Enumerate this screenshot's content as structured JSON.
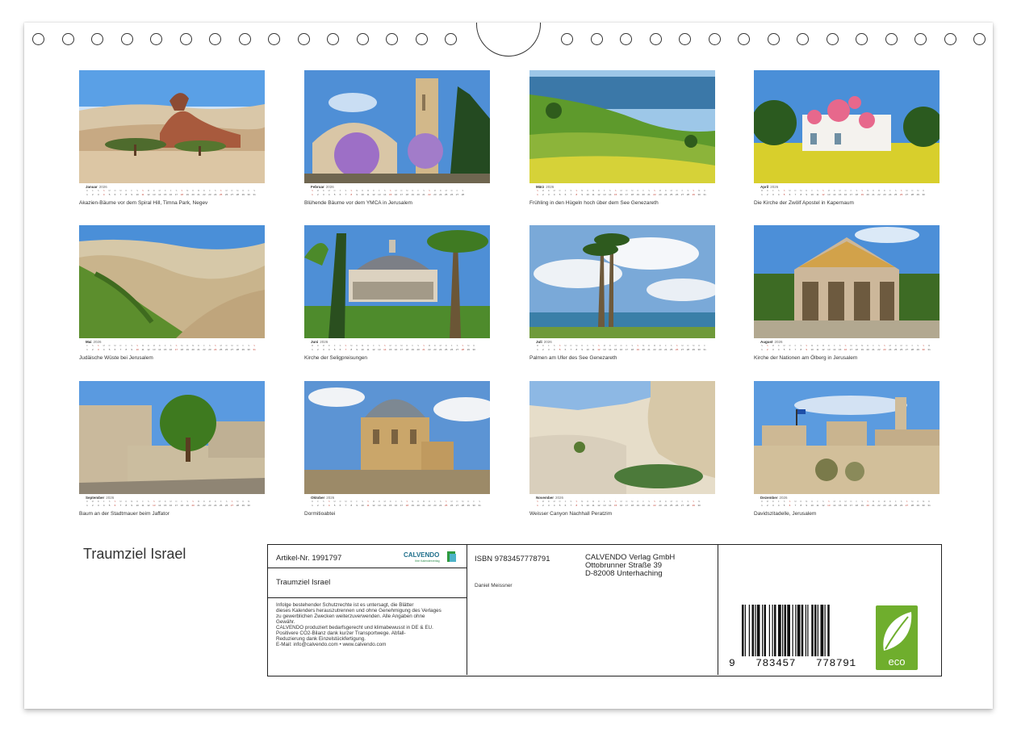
{
  "months": [
    {
      "name": "Januar",
      "year": "2026",
      "caption": "Akazien-Bäume vor dem Spiral Hill, Timna Park, Negev",
      "days": 31
    },
    {
      "name": "Februar",
      "year": "2026",
      "caption": "Blühende Bäume vor dem YMCA in Jerusalem",
      "days": 28
    },
    {
      "name": "März",
      "year": "2026",
      "caption": "Frühling in den Hügeln hoch über dem See Genezareth",
      "days": 31
    },
    {
      "name": "April",
      "year": "2026",
      "caption": "Die Kirche der Zwölf Apostel in Kapernaum",
      "days": 30
    },
    {
      "name": "Mai",
      "year": "2026",
      "caption": "Judäische Wüste bei Jerusalem",
      "days": 31
    },
    {
      "name": "Juni",
      "year": "2026",
      "caption": "Kirche der Seligpreisungen",
      "days": 30
    },
    {
      "name": "Juli",
      "year": "2026",
      "caption": "Palmen am Ufer des See Genezareth",
      "days": 31
    },
    {
      "name": "August",
      "year": "2026",
      "caption": "Kirche der Nationen am Ölberg in Jerusalem",
      "days": 31
    },
    {
      "name": "September",
      "year": "2026",
      "caption": "Baum an der Stadtmauer beim Jaffator",
      "days": 30
    },
    {
      "name": "Oktober",
      "year": "2026",
      "caption": "Dormitioabtei",
      "days": 31
    },
    {
      "name": "November",
      "year": "2026",
      "caption": "Weisser Canyon Nachhall Peratzim",
      "days": 30
    },
    {
      "name": "Dezember",
      "year": "2026",
      "caption": "Davidszitadelle, Jerusalem",
      "days": 31
    }
  ],
  "title": "Traumziel Israel",
  "info": {
    "article": "Artikel-Nr. 1991797",
    "brand": "CALVENDO",
    "brand_sub": "Ihre Kalenderverlag",
    "subtitle": "Traumziel Israel",
    "legal": "Infolge bestehender Schutzrechte ist es untersagt, die Blätter\ndieses Kalenders herauszutrennen und ohne Genehmigung des Verlages\nzu gewerblichen Zwecken weiterzuverwenden. Alle Angaben ohne\nGewähr.\nCALVENDO produziert bedarfsgerecht und klimabewusst in DE & EU.\nPositivere CO2-Bilanz dank kurzer Transportwege. Abfall-\nReduzierung dank Einzelstückfertigung.\nE-Mail: info@calvendo.com • www.calvendo.com",
    "isbn": "ISBN 9783457778791",
    "publisher_line1": "CALVENDO Verlag GmbH",
    "publisher_line2": "Ottobrunner Straße 39",
    "publisher_line3": "D-82008 Unterhaching",
    "author": "Daniel Meissner",
    "barcode_digits": "9   783457   778791",
    "eco_label": "eco"
  }
}
